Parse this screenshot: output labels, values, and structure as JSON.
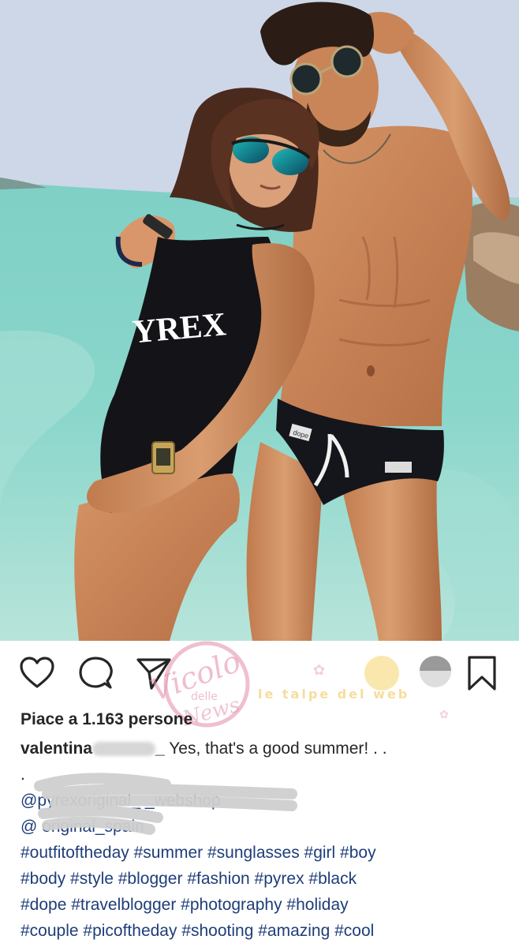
{
  "post": {
    "likes_text": "Piace a 1.163 persone",
    "username": "valentina",
    "username_suffix": "_",
    "caption": "Yes, that's a good summer! . .",
    "dot_line": ".",
    "mention1": "@pyrexoriginal_                                  _webshop",
    "mention2": "@           original_spain",
    "hashtags": [
      "#outfitoftheday #summer #sunglasses #girl #boy",
      "#body #style #blogger #fashion #pyrex #black",
      "#dope #travelblogger #photography #holiday",
      "#couple #picoftheday #shooting #amazing #cool"
    ]
  },
  "photo": {
    "swimsuit_text": "YREX",
    "trunks_tag": "dope"
  },
  "watermarks": {
    "left_text": "Vicolo delle News",
    "right_text": "le talpe del web"
  },
  "icons": {
    "like": "heart-icon",
    "comment": "comment-icon",
    "share": "paper-plane-icon",
    "save": "bookmark-icon"
  },
  "colors": {
    "hashtag": "#1e3d7a",
    "text": "#262626",
    "watermark_pink": "#e38aa8"
  }
}
